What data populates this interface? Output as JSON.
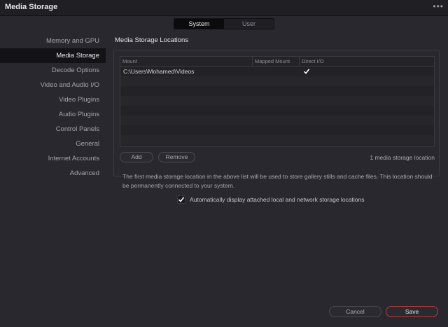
{
  "window": {
    "title": "Media Storage",
    "more_glyph": "•••"
  },
  "scope_tabs": [
    {
      "label": "System",
      "active": true
    },
    {
      "label": "User",
      "active": false
    }
  ],
  "sidebar": {
    "items": [
      {
        "label": "Memory and GPU",
        "active": false
      },
      {
        "label": "Media Storage",
        "active": true
      },
      {
        "label": "Decode Options",
        "active": false
      },
      {
        "label": "Video and Audio I/O",
        "active": false
      },
      {
        "label": "Video Plugins",
        "active": false
      },
      {
        "label": "Audio Plugins",
        "active": false
      },
      {
        "label": "Control Panels",
        "active": false
      },
      {
        "label": "General",
        "active": false
      },
      {
        "label": "Internet Accounts",
        "active": false
      },
      {
        "label": "Advanced",
        "active": false
      }
    ]
  },
  "section": {
    "title": "Media Storage Locations"
  },
  "table": {
    "columns": [
      "Mount",
      "Mapped Mount",
      "Direct I/O"
    ],
    "rows": [
      {
        "mount": "C:\\Users\\Mohamed\\Videos",
        "mapped": "",
        "direct_io": true
      }
    ]
  },
  "buttons": {
    "add": "Add",
    "remove": "Remove",
    "cancel": "Cancel",
    "save": "Save"
  },
  "count_text": "1 media storage location",
  "info_text": "The first media storage location in the above list will be used to store gallery stills and cache files. This location should be permanently connected to your system.",
  "auto_display": {
    "label": "Automatically display attached local and network storage locations",
    "checked": true
  },
  "colors": {
    "accent_save": "#c23a3a",
    "active_bg": "#131316"
  }
}
